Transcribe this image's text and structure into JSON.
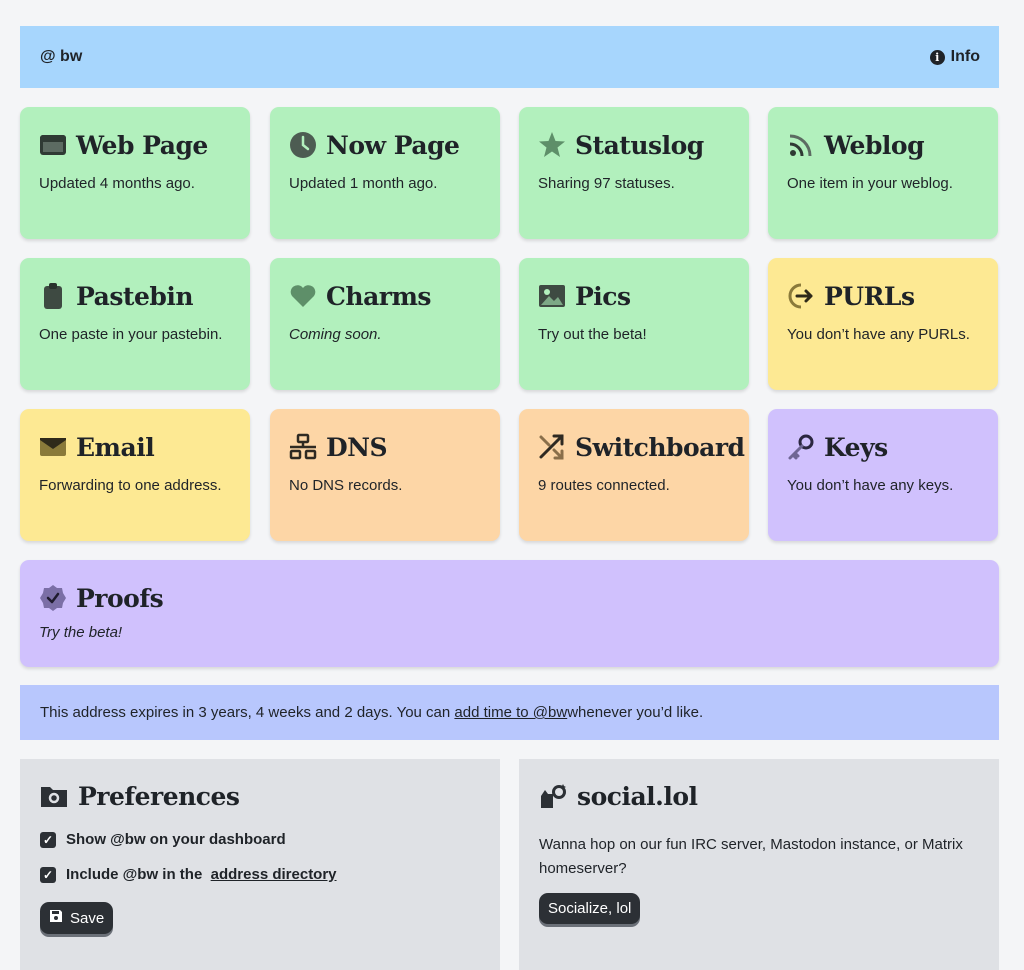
{
  "topbar": {
    "address": "@ bw",
    "info_label": "Info"
  },
  "cards": [
    {
      "title": "Web Page",
      "desc": "Updated 4 months ago.",
      "icon": "browser-icon",
      "color": "#b2f0bd"
    },
    {
      "title": "Now Page",
      "desc": "Updated 1 month ago.",
      "icon": "clock-icon",
      "color": "#b2f0bd"
    },
    {
      "title": "Statuslog",
      "desc": "Sharing 97 statuses.",
      "icon": "star-icon",
      "color": "#b2f0bd"
    },
    {
      "title": "Weblog",
      "desc": "One item in your weblog.",
      "icon": "rss-icon",
      "color": "#b2f0bd"
    },
    {
      "title": "Pastebin",
      "desc": "One paste in your pastebin.",
      "icon": "clipboard-icon",
      "color": "#b2f0bd"
    },
    {
      "title": "Charms",
      "desc": "Coming soon.",
      "icon": "heart-icon",
      "color": "#b2f0bd"
    },
    {
      "title": "Pics",
      "desc": "Try out the beta!",
      "icon": "image-icon",
      "color": "#b2f0bd"
    },
    {
      "title": "PURLs",
      "desc": "You don’t have any PURLs.",
      "icon": "redirect-icon",
      "color": "#fde993"
    },
    {
      "title": "Email",
      "desc": "Forwarding to one address.",
      "icon": "envelope-icon",
      "color": "#fde993"
    },
    {
      "title": "DNS",
      "desc": "No DNS records.",
      "icon": "network-icon",
      "color": "#fdd6a6"
    },
    {
      "title": "Switchboard",
      "desc": "9 routes connected.",
      "icon": "shuffle-icon",
      "color": "#fdd6a6"
    },
    {
      "title": "Keys",
      "desc": "You don’t have any keys.",
      "icon": "key-icon",
      "color": "#d0c1fd"
    },
    {
      "title": "Proofs",
      "desc": "Try the beta!",
      "icon": "badge-check-icon",
      "color": "#d0c1fd"
    }
  ],
  "notice": {
    "before": "This address expires in 3 years, 4 weeks and 2 days. You can ",
    "link": "add time to @bw",
    "after": " whenever you’d like."
  },
  "preferences": {
    "title": "Preferences",
    "option1": "Show @bw on your dashboard",
    "option2_before": "Include @bw in the ",
    "option2_link": "address directory",
    "save_label": "Save"
  },
  "social": {
    "title": "social.lol",
    "text": "Wanna hop on our fun IRC server, Mastodon instance, or Matrix homeserver?",
    "button_label": "Socialize, lol"
  }
}
